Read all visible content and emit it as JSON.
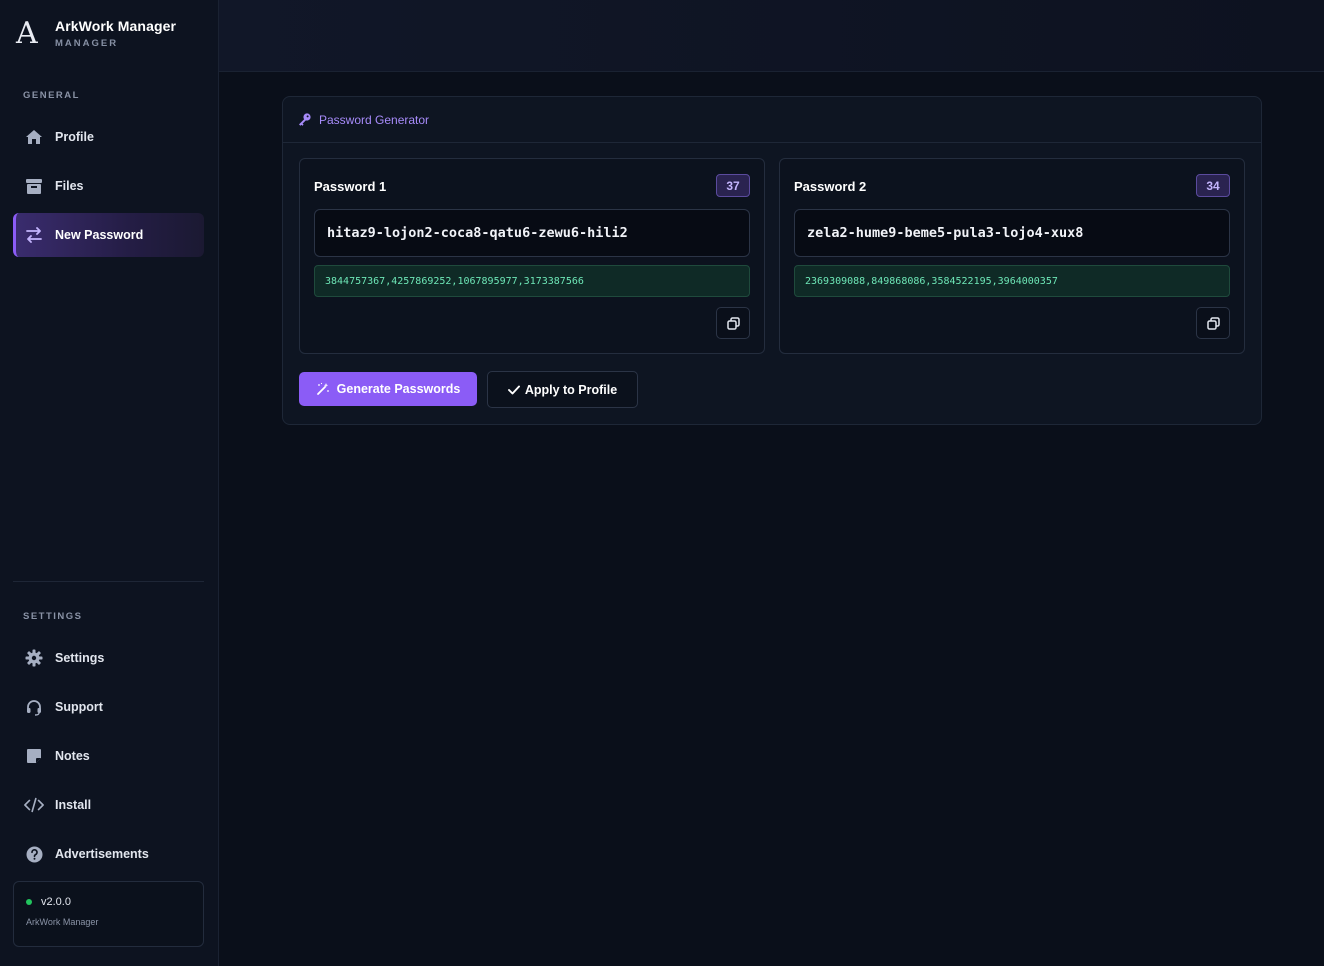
{
  "brand": {
    "logo_letter": "A",
    "title": "ArkWork Manager",
    "subtitle": "MANAGER"
  },
  "sidebar": {
    "general_label": "GENERAL",
    "general_items": [
      {
        "label": "Profile",
        "icon": "home-icon"
      },
      {
        "label": "Files",
        "icon": "archive-icon"
      },
      {
        "label": "New Password",
        "icon": "swap-arrows-icon",
        "active": true
      }
    ],
    "settings_label": "SETTINGS",
    "settings_items": [
      {
        "label": "Settings",
        "icon": "gear-icon"
      },
      {
        "label": "Support",
        "icon": "headset-icon"
      },
      {
        "label": "Notes",
        "icon": "sticky-note-icon"
      },
      {
        "label": "Install",
        "icon": "code-icon"
      },
      {
        "label": "Advertisements",
        "icon": "question-circle-icon"
      }
    ],
    "version": {
      "number": "v2.0.0",
      "app_name": "ArkWork Manager",
      "status_color": "#22c55e"
    }
  },
  "panel": {
    "title": "Password Generator",
    "passwords": [
      {
        "label": "Password 1",
        "length": "37",
        "value": "hitaz9-lojon2-coca8-qatu6-zewu6-hili2",
        "seed": "3844757367,4257869252,1067895977,3173387566"
      },
      {
        "label": "Password 2",
        "length": "34",
        "value": "zela2-hume9-beme5-pula3-lojo4-xux8",
        "seed": "2369309088,849868086,3584522195,3964000357"
      }
    ],
    "generate_label": "Generate Passwords",
    "apply_label": "Apply to Profile"
  },
  "colors": {
    "accent": "#8b5cf6",
    "accent_text": "#a78bfa",
    "seed_text": "#6ee7b7",
    "background": "#0a0f1a"
  }
}
